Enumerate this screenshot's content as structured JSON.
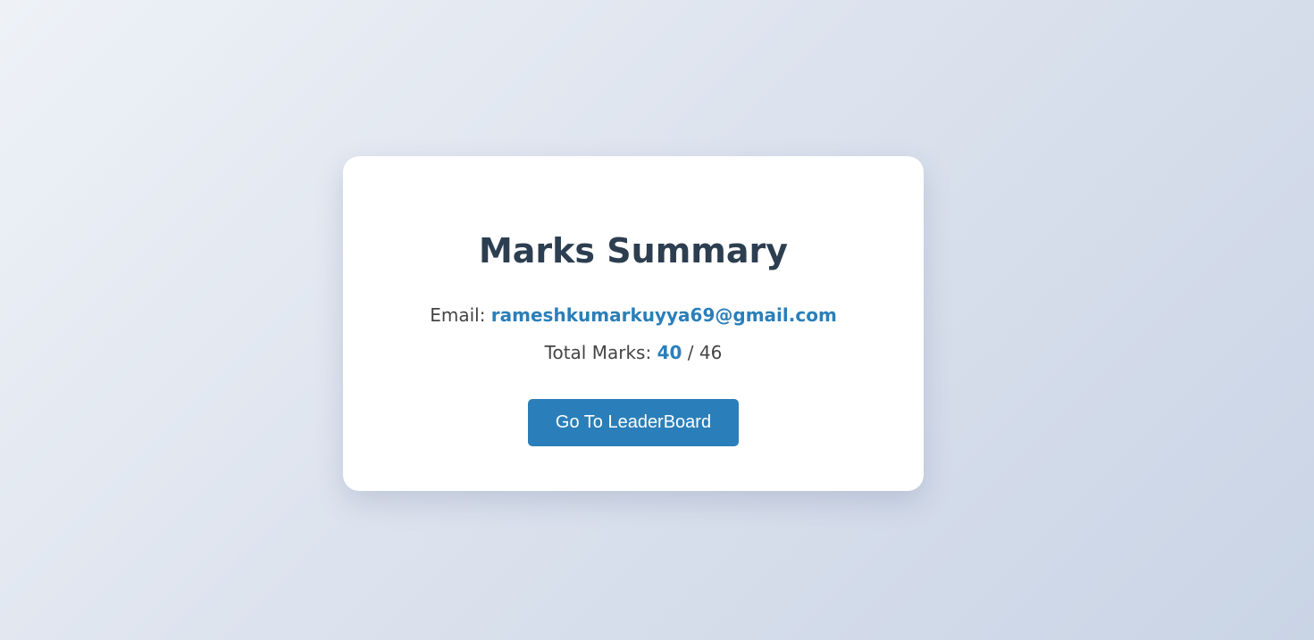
{
  "summary": {
    "title": "Marks Summary",
    "email_label": "Email:",
    "email_value": "rameshkumarkuyya69@gmail.com",
    "marks_label": "Total Marks:",
    "marks_scored": "40",
    "marks_separator": "/",
    "marks_total": "46",
    "button_label": "Go To LeaderBoard"
  },
  "colors": {
    "accent": "#2a7fba",
    "title": "#2c3e50",
    "text": "#444444",
    "card": "#ffffff"
  }
}
